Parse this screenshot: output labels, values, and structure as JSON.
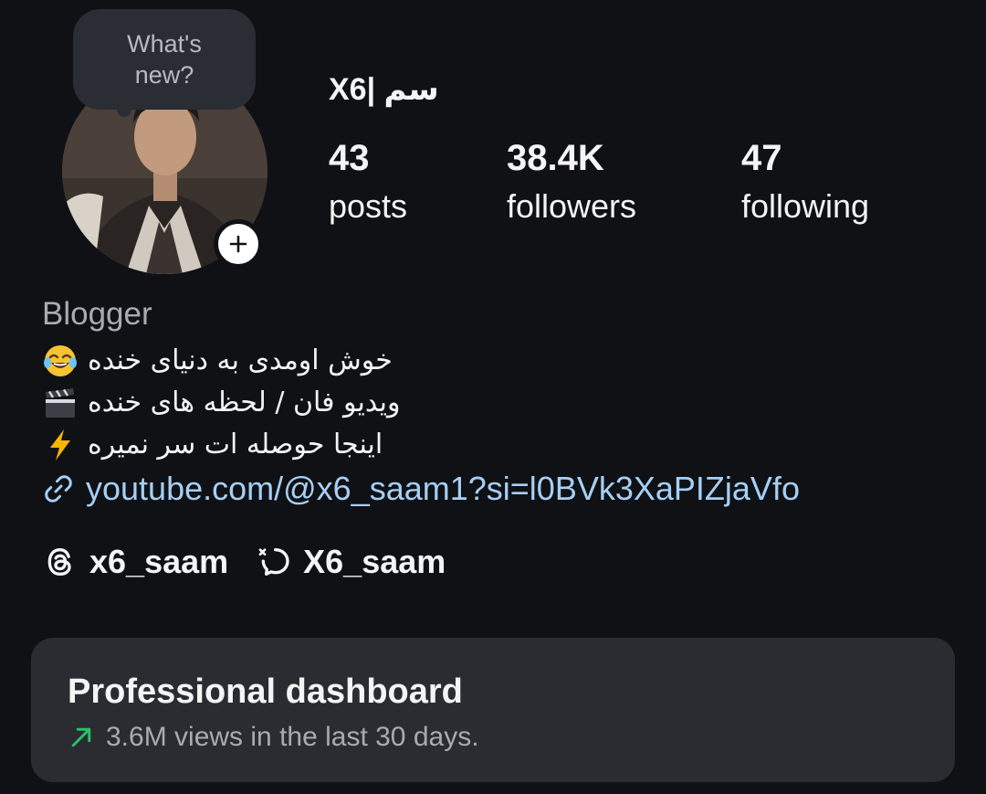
{
  "note": {
    "text": "What's new?"
  },
  "profile": {
    "name": "X6| سم",
    "stats": [
      {
        "value": "43",
        "label": "posts"
      },
      {
        "value": "38.4K",
        "label": "followers"
      },
      {
        "value": "47",
        "label": "following"
      }
    ],
    "category": "Blogger",
    "bio_lines": [
      {
        "text": "خوش اومدی به دنیای خنده",
        "emoji": "rolling-laughing-emoji"
      },
      {
        "text": "ویدیو فان / لحظه های  خنده",
        "emoji": "clapper-board-emoji"
      },
      {
        "text": "اینجا حوصله ات سر نمیره",
        "emoji": "lightning-emoji"
      }
    ],
    "link": "youtube.com/@x6_saam1?si=l0BVk3XaPIZjaVfo",
    "threads_handle": "x6_saam",
    "messenger_handle": "X6_saam"
  },
  "dashboard": {
    "title": "Professional dashboard",
    "subtitle": "3.6M views in the last 30 days.",
    "trend_color": "#2bbf6a"
  },
  "colors": {
    "background": "#0f1115",
    "card": "#2a2c31",
    "link": "#a6cff5",
    "muted": "#a8abb2"
  },
  "icons": [
    "plus-icon",
    "link-icon",
    "threads-icon",
    "messenger-icon",
    "trend-up-icon"
  ]
}
